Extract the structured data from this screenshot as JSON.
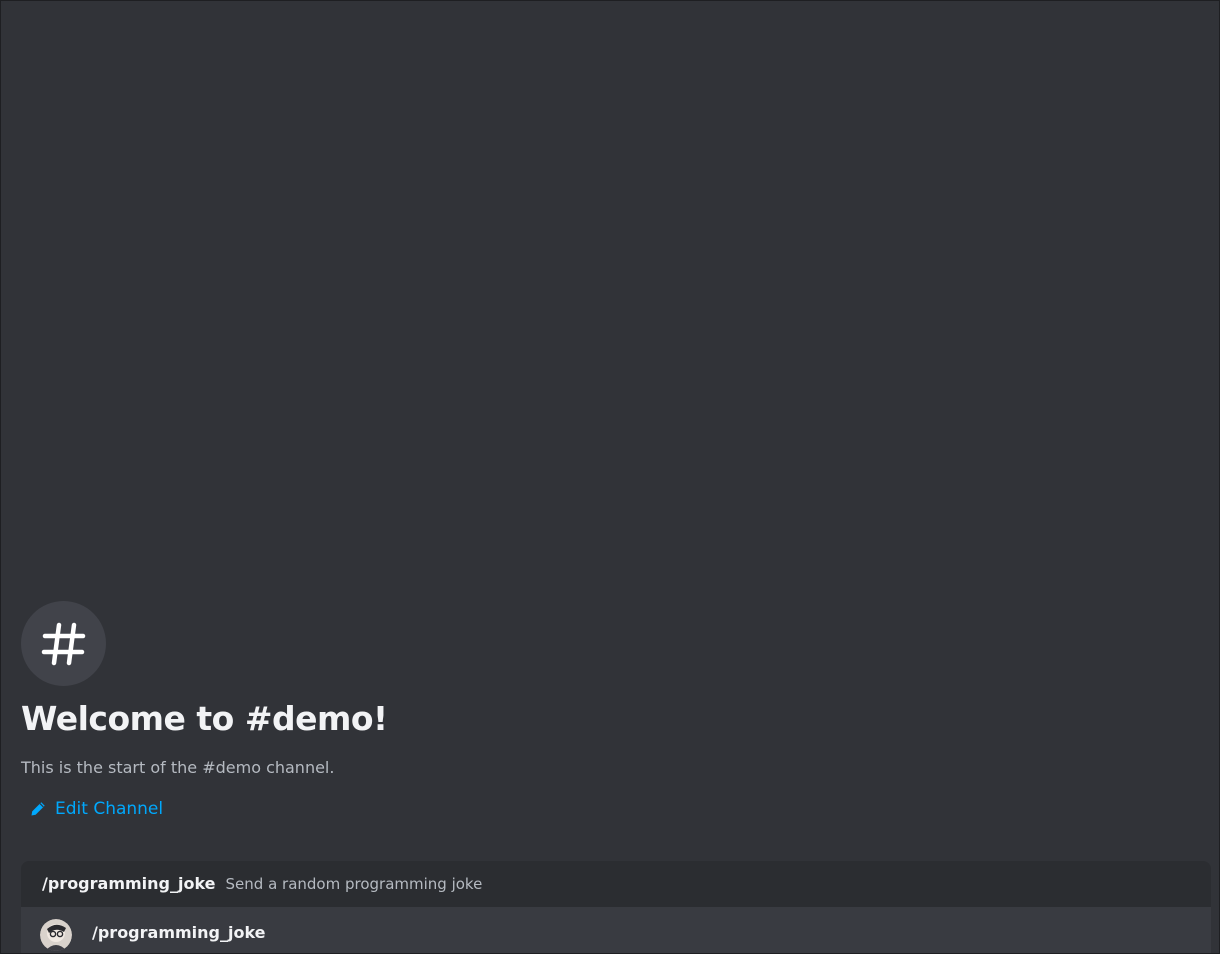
{
  "channel": {
    "icon": "hashtag-icon",
    "welcome_title": "Welcome to #demo!",
    "welcome_subtitle": "This is the start of the #demo channel.",
    "edit_label": "Edit Channel",
    "edit_icon": "pencil-icon"
  },
  "command_popup": {
    "command_name": "/programming_joke",
    "command_description": "Send a random programming joke",
    "option": {
      "avatar_icon": "bot-avatar",
      "label": "/programming_joke"
    }
  },
  "colors": {
    "background": "#313338",
    "link": "#00a8fc",
    "popup_header": "#2b2d31",
    "popup_option_highlight": "#393b41"
  }
}
